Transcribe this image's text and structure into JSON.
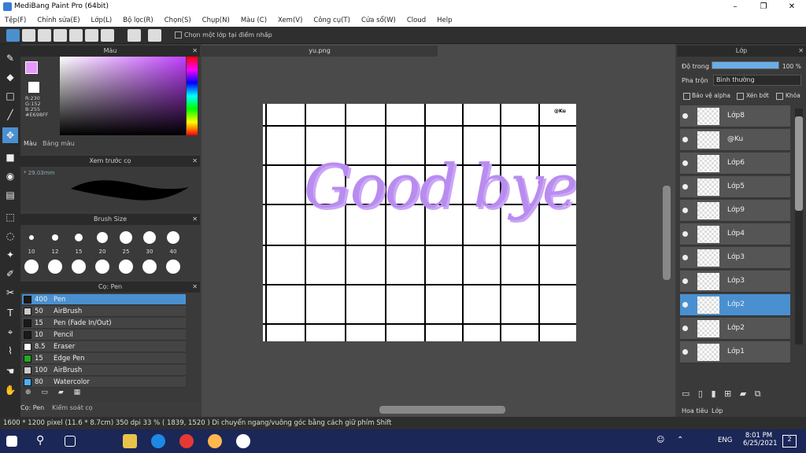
{
  "app": {
    "title": "MediBang Paint Pro (64bit)",
    "minimize": "–",
    "maximize": "❐",
    "close": "✕"
  },
  "menu": [
    "Tệp(F)",
    "Chỉnh sửa(E)",
    "Lớp(L)",
    "Bộ lọc(R)",
    "Chọn(S)",
    "Chụp(N)",
    "Màu (C)",
    "Xem(V)",
    "Công cụ(T)",
    "Cửa sổ(W)",
    "Cloud",
    "Help"
  ],
  "toolbar": {
    "select_one_layer_label": "Chọn một lớp tại điểm nhấp"
  },
  "color_panel": {
    "title": "Màu",
    "r": "R:230",
    "g": "G:152",
    "b": "B:255",
    "hex": "#E698FF",
    "tab_color": "Màu",
    "tab_palette": "Bảng màu",
    "current_color": "#e698ff"
  },
  "brush_preview": {
    "title": "Xem trước cọ",
    "size": "* 29.03mm"
  },
  "brush_size": {
    "title": "Brush Size",
    "sizes": [
      "10",
      "12",
      "15",
      "20",
      "25",
      "30",
      "40"
    ]
  },
  "brush_list": {
    "title": "Cọ: Pen",
    "items": [
      {
        "size": "400",
        "name": "Pen",
        "color": "#1a1a1a"
      },
      {
        "size": "50",
        "name": "AirBrush",
        "color": "#cccccc"
      },
      {
        "size": "15",
        "name": "Pen (Fade In/Out)",
        "color": "#1a1a1a"
      },
      {
        "size": "10",
        "name": "Pencil",
        "color": "#1a1a1a"
      },
      {
        "size": "8.5",
        "name": "Eraser",
        "color": "#ffffff"
      },
      {
        "size": "15",
        "name": "Edge Pen",
        "color": "#22aa22"
      },
      {
        "size": "100",
        "name": "AirBrush",
        "color": "#cccccc"
      },
      {
        "size": "80",
        "name": "Watercolor",
        "color": "#4ab0ff"
      }
    ],
    "tab_pen": "Cọ: Pen",
    "tab_brush_control": "Kiểm soát cọ"
  },
  "document": {
    "tab": "yu.png",
    "artwork_text": "Good bye",
    "watermark": "@Ku"
  },
  "layers_panel": {
    "title": "Lớp",
    "opacity_label": "Độ trong",
    "opacity_value": "100 %",
    "opacity": 1.0,
    "blend_label": "Pha trộn",
    "blend_value": "Bình thường",
    "protect_alpha": "Bảo vệ alpha",
    "clipping": "Xén bớt",
    "lock": "Khóa",
    "layers": [
      "Lớp8",
      "@Ku",
      "Lớp6",
      "Lớp5",
      "Lớp9",
      "Lớp4",
      "Lớp3",
      "Lớp3",
      "Lớp2",
      "Lớp2",
      "Lớp1"
    ],
    "selected_index": 8,
    "tab_hoatieu": "Hoa tiêu",
    "tab_lop": "Lớp"
  },
  "status": {
    "size": "1600 * 1200 pixel",
    "mm": "(11.6 * 8.7cm)",
    "dpi": "350 dpi",
    "zoom": "33 %",
    "coord": "( 1839, 1520 )",
    "hint": "Di chuyển ngang/vuông góc bằng cách giữ phím Shift"
  },
  "taskbar": {
    "lang": "ENG",
    "time": "8:01 PM",
    "date": "6/25/2021",
    "notif": "2"
  }
}
